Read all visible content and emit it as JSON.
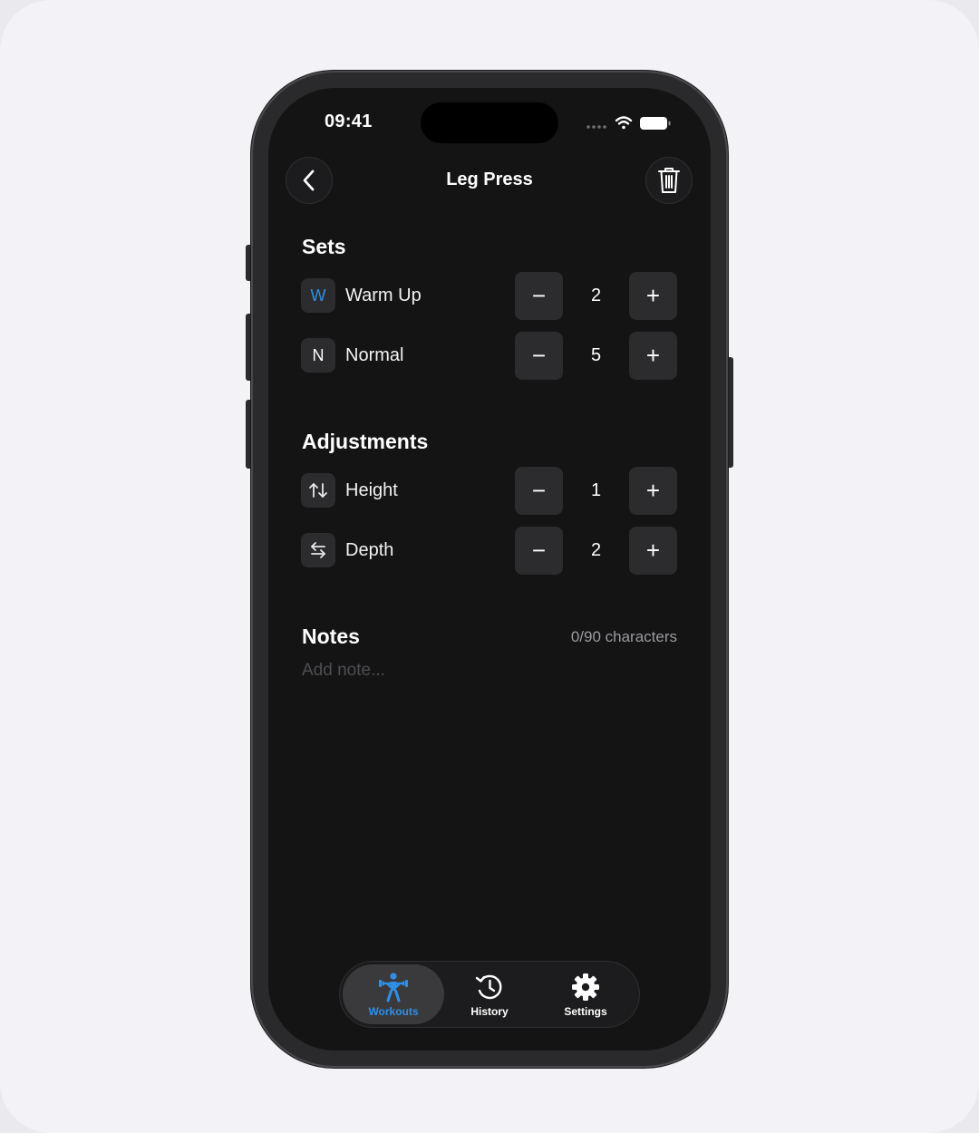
{
  "status": {
    "time": "09:41"
  },
  "nav": {
    "title": "Leg Press"
  },
  "sets": {
    "title": "Sets",
    "rows": [
      {
        "badge": "W",
        "label": "Warm Up",
        "value": "2",
        "badge_color": "#2f8fe6"
      },
      {
        "badge": "N",
        "label": "Normal",
        "value": "5",
        "badge_color": "#ffffff"
      }
    ]
  },
  "adjustments": {
    "title": "Adjustments",
    "rows": [
      {
        "icon": "vertical-arrows-icon",
        "label": "Height",
        "value": "1"
      },
      {
        "icon": "horizontal-arrows-icon",
        "label": "Depth",
        "value": "2"
      }
    ]
  },
  "stepper": {
    "minus": "−",
    "plus": "+"
  },
  "notes": {
    "title": "Notes",
    "count": "0/90 characters",
    "placeholder": "Add note..."
  },
  "tabbar": {
    "active": "Workouts",
    "accent": "#2f8fe6",
    "tabs": [
      {
        "label": "Workouts",
        "icon": "weightlifter-icon"
      },
      {
        "label": "History",
        "icon": "history-clock-icon"
      },
      {
        "label": "Settings",
        "icon": "gear-icon"
      }
    ]
  }
}
